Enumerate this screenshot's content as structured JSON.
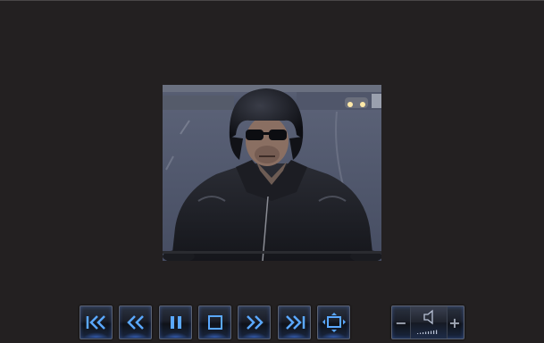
{
  "player": {
    "title": "",
    "video": {
      "content": "rider-in-helmet-on-motorcycle"
    },
    "controls": {
      "buttons": [
        {
          "name": "skip-to-start-button",
          "icon": "skip-back-icon"
        },
        {
          "name": "rewind-button",
          "icon": "rewind-icon"
        },
        {
          "name": "pause-button",
          "icon": "pause-icon"
        },
        {
          "name": "stop-button",
          "icon": "stop-icon"
        },
        {
          "name": "fast-forward-button",
          "icon": "fast-forward-icon"
        },
        {
          "name": "skip-to-end-button",
          "icon": "skip-forward-icon"
        },
        {
          "name": "fullscreen-button",
          "icon": "fullscreen-icon"
        }
      ],
      "volume": {
        "minus_label": "−",
        "plus_label": "+",
        "icon": "speaker-icon",
        "level": 0.55
      }
    },
    "colors": {
      "background": "#232021",
      "icon_accent": "#5aa8ff",
      "button_glow": "#4682ff"
    }
  }
}
